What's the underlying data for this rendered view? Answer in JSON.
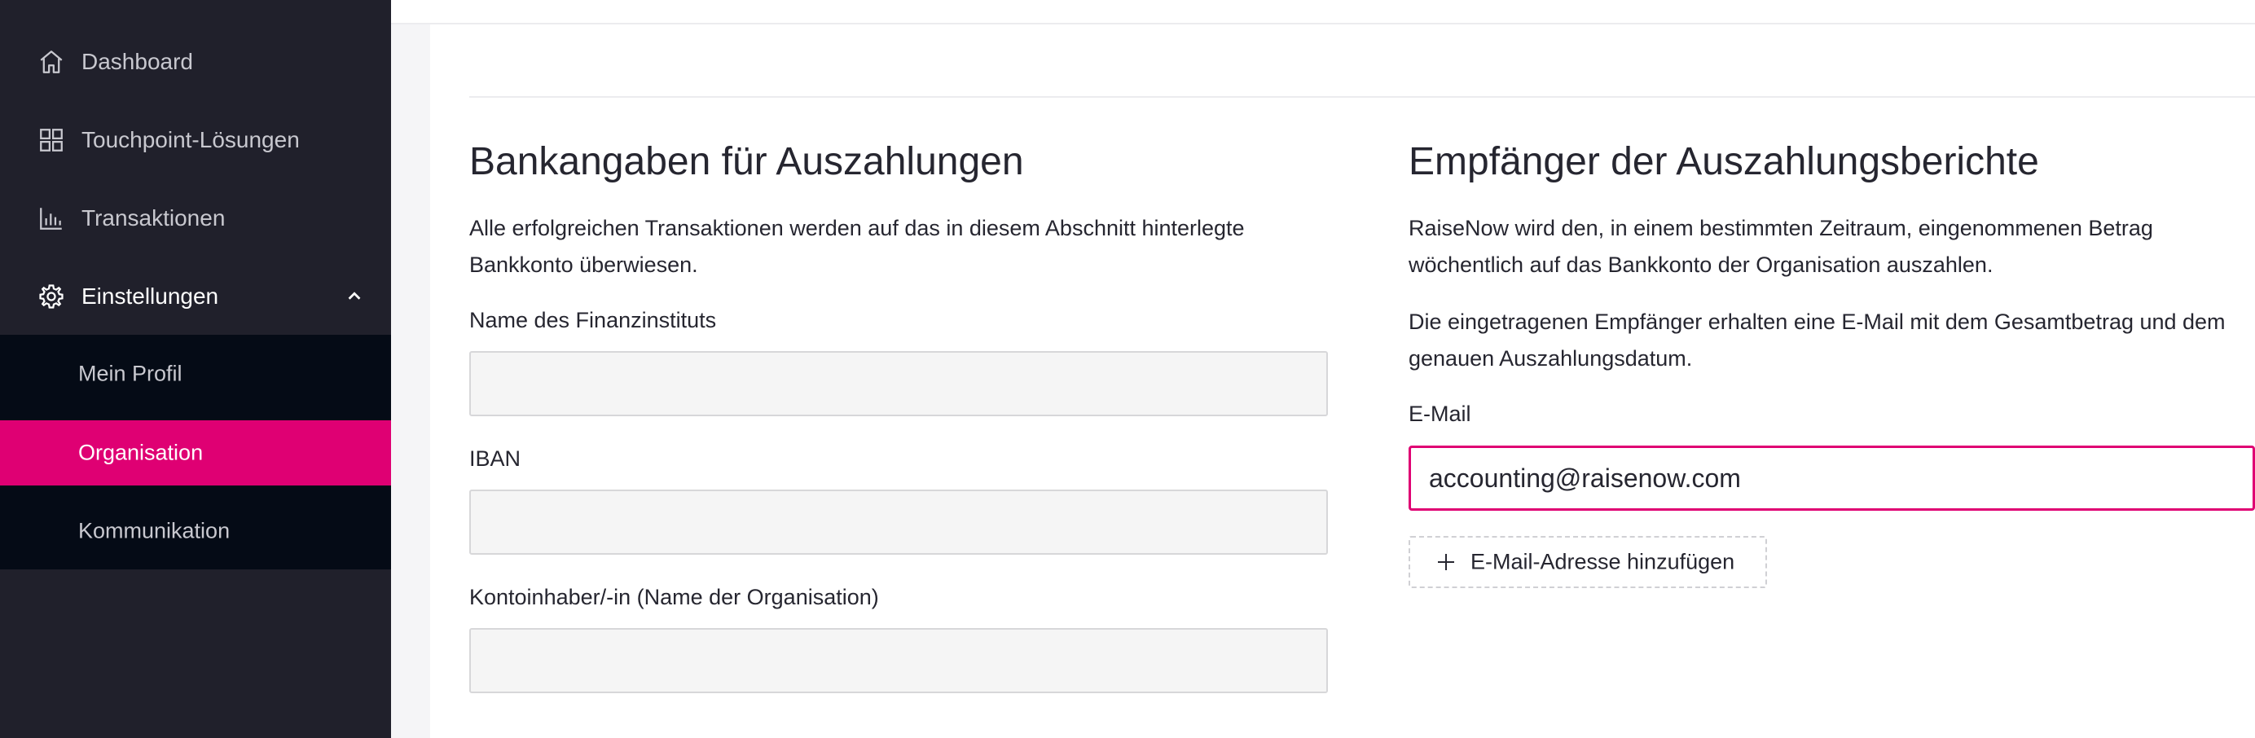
{
  "sidebar": {
    "items": [
      {
        "label": "Dashboard",
        "icon": "home-icon"
      },
      {
        "label": "Touchpoint-Lösungen",
        "icon": "grid-icon"
      },
      {
        "label": "Transaktionen",
        "icon": "bar-chart-icon"
      },
      {
        "label": "Einstellungen",
        "icon": "gear-icon",
        "expanded": true
      }
    ],
    "subitems": [
      {
        "label": "Mein Profil"
      },
      {
        "label": "Organisation",
        "active": true
      },
      {
        "label": "Kommunikation"
      }
    ]
  },
  "bank": {
    "title": "Bankangaben für Auszahlungen",
    "description": "Alle erfolgreichen Transaktionen werden auf das in diesem Abschnitt hinterlegte Bankkonto überwiesen.",
    "fields": [
      {
        "label": "Name des Finanzinstituts",
        "value": ""
      },
      {
        "label": "IBAN",
        "value": ""
      },
      {
        "label": "Kontoinhaber/-in (Name der Organisation)",
        "value": ""
      }
    ]
  },
  "recipients": {
    "title": "Empfänger der Auszahlungsberichte",
    "description1": "RaiseNow wird den, in einem bestimmten Zeitraum, eingenommenen Betrag wöchentlich auf das Bankkonto der Organisation auszahlen.",
    "description2": "Die eingetragenen Empfänger erhalten eine E-Mail mit dem Gesamtbetrag und dem genauen Auszahlungsdatum.",
    "email_label": "E-Mail",
    "email_value": "accounting@raisenow.com",
    "add_label": "E-Mail-Adresse hinzufügen"
  },
  "colors": {
    "sidebar_bg": "#20202b",
    "submenu_bg": "#050b16",
    "accent": "#df0073"
  }
}
